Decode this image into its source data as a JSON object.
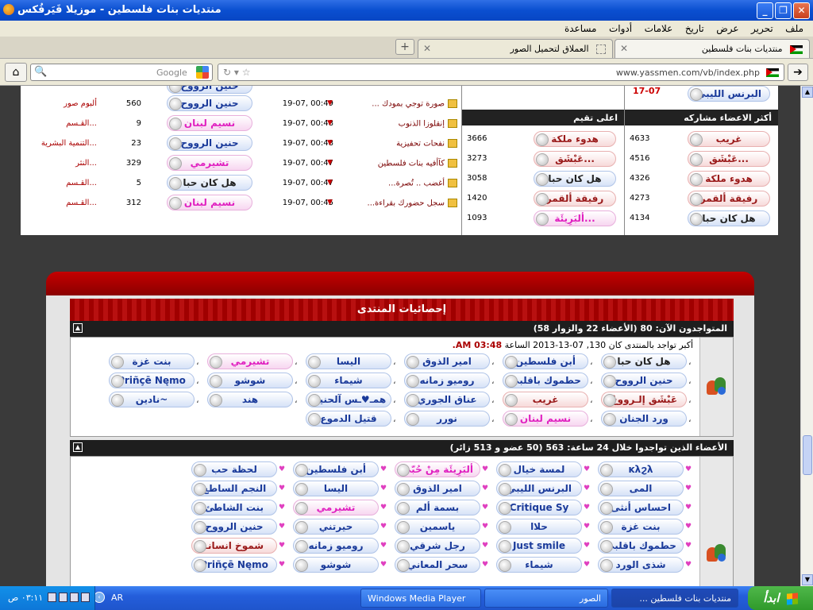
{
  "window": {
    "title": "منتديات بنات فلسطين - موزيلا فَيَرفُكس",
    "buttons": [
      "_",
      "❐",
      "✕"
    ]
  },
  "menu": [
    "ملف",
    "تحرير",
    "عرض",
    "تاريخ",
    "علامات",
    "أدوات",
    "مساعدة"
  ],
  "tabs": [
    {
      "label": "منتديات بنات فلسطين",
      "active": true
    },
    {
      "label": "العملاق لتحميل الصور",
      "active": false
    }
  ],
  "new_tab": "+",
  "nav": {
    "url": "www.yassmen.com/vb/index.php",
    "search_placeholder": "Google"
  },
  "latest": [
    {
      "topic": "صورة توجي بمودك ...",
      "time": "19-07, 00:49",
      "poster": "حنين الرووح",
      "poster_style": "blue",
      "replies": "560",
      "forum": "ألبوم صور"
    },
    {
      "topic": "إنقلوزا الذنوب",
      "time": "19-07, 00:48",
      "poster": "نسيم لبنان",
      "poster_style": "pink",
      "replies": "9",
      "forum": "القـسم..."
    },
    {
      "topic": "نفحات تحفيزية",
      "time": "19-07, 00:48",
      "poster": "حنين الرووح",
      "poster_style": "blue",
      "replies": "23",
      "forum": "التنمية البشرية..."
    },
    {
      "topic": "كآأفيه بنات فلسطين",
      "time": "19-07, 00:47",
      "poster": "تشيرمي",
      "poster_style": "pink",
      "replies": "329",
      "forum": "النثر..."
    },
    {
      "topic": "أغضب .. تُصرة...",
      "time": "19-07, 00:47",
      "poster": "هل كان حبا",
      "poster_style": "dark",
      "replies": "5",
      "forum": "القـسم..."
    },
    {
      "topic": "سجل حضورك بقراءة...",
      "time": "19-07, 00:45",
      "poster": "نسيم لبنان",
      "poster_style": "pink",
      "replies": "312",
      "forum": "القـسم..."
    }
  ],
  "partial_top_poster": "حنين الرووح",
  "top_rated": {
    "title": "اعلى تقيم",
    "rows": [
      {
        "name": "هدوء ملكة",
        "value": "3666",
        "style": "red"
      },
      {
        "name": "عَبْشَق...",
        "value": "3273",
        "style": "red"
      },
      {
        "name": "هل كان حبا",
        "value": "3058",
        "style": "dark"
      },
      {
        "name": "رفيقة ألقمر",
        "value": "1420",
        "style": "red"
      },
      {
        "name": "ألبَرِيئَة...",
        "value": "1093",
        "style": "pink"
      }
    ]
  },
  "top_posters": {
    "title": "أكثر الاعضاء مشاركه",
    "top_name": "البرنس الليبي",
    "top_date": "17-07",
    "rows": [
      {
        "name": "غريب",
        "value": "4633",
        "style": "red"
      },
      {
        "name": "عَبْشَق...",
        "value": "4516",
        "style": "red"
      },
      {
        "name": "هدوء ملكة",
        "value": "4326",
        "style": "red"
      },
      {
        "name": "رفيقة ألقمر",
        "value": "4273",
        "style": "red"
      },
      {
        "name": "هل كان حبا",
        "value": "4134",
        "style": "dark"
      }
    ]
  },
  "stats": {
    "title": "إحصائيات المنتدى",
    "online_header": "المتواجدون الآن: 80 (الأعضاء 22 والزوار 58)",
    "record_text": "أكبر تواجد بالمنتدى كان 130, 07-13-2013 الساعة",
    "record_time": "03:48 AM.",
    "online_users": [
      {
        "name": "هل كان حبا",
        "style": "dark"
      },
      {
        "name": "أبن فلسطين",
        "style": "blue"
      },
      {
        "name": "امير الذوق",
        "style": "blue"
      },
      {
        "name": "اليسا",
        "style": "blue"
      },
      {
        "name": "تشيرمي",
        "style": "pink"
      },
      {
        "name": "بنت غزة",
        "style": "blue"
      },
      {
        "name": "حنين الرووح",
        "style": "blue"
      },
      {
        "name": "حطموك باقلبي",
        "style": "blue"
      },
      {
        "name": "روميو زمانه",
        "style": "blue"
      },
      {
        "name": "شيماء",
        "style": "blue"
      },
      {
        "name": "شوشو",
        "style": "blue"
      },
      {
        "name": "Priñçē Nęmo",
        "style": "blue"
      },
      {
        "name": "عَبْشَق إلـرووحْ",
        "style": "red"
      },
      {
        "name": "غريب",
        "style": "red"
      },
      {
        "name": "عناق الجوري",
        "style": "blue"
      },
      {
        "name": "همـ♥ـس آلحنين",
        "style": "blue"
      },
      {
        "name": "هند",
        "style": "blue"
      },
      {
        "name": "نادين~",
        "style": "blue"
      },
      {
        "name": "ورد الجنان",
        "style": "blue"
      },
      {
        "name": "نسيم لبنان",
        "style": "pink"
      },
      {
        "name": "نورر",
        "style": "blue"
      },
      {
        "name": "قتيل الدموع",
        "style": "blue"
      }
    ],
    "day_header": "الأعضاء الذين تواجدوا خلال 24 ساعة: 563 (50 عضو و 513 زائر)",
    "day_users": [
      {
        "name": "ĸλϩλ",
        "style": "blue"
      },
      {
        "name": "لمسة خيال",
        "style": "blue"
      },
      {
        "name": "ألبَرِيئَة مِنْ حُبّي",
        "style": "pink"
      },
      {
        "name": "أبن فلسطين",
        "style": "blue"
      },
      {
        "name": "لحظة حب",
        "style": "blue"
      },
      {
        "name": "المى",
        "style": "blue"
      },
      {
        "name": "البرنس الليبي",
        "style": "blue"
      },
      {
        "name": "امير الذوق",
        "style": "blue"
      },
      {
        "name": "اليسا",
        "style": "blue"
      },
      {
        "name": "النجم الساطع",
        "style": "blue"
      },
      {
        "name": "احساس أنثى",
        "style": "blue"
      },
      {
        "name": "Critique Sy",
        "style": "blue"
      },
      {
        "name": "بسمة ألم",
        "style": "blue"
      },
      {
        "name": "تشيرمي",
        "style": "pink"
      },
      {
        "name": "بنت الشاطئ",
        "style": "blue"
      },
      {
        "name": "بنت غزة",
        "style": "blue"
      },
      {
        "name": "حلاا",
        "style": "blue"
      },
      {
        "name": "ياسمين",
        "style": "blue"
      },
      {
        "name": "حيرتني",
        "style": "blue"
      },
      {
        "name": "حنين الرووح",
        "style": "blue"
      },
      {
        "name": "حطموك باقلبي",
        "style": "blue"
      },
      {
        "name": "Just smile",
        "style": "blue"
      },
      {
        "name": "رجل شرقي",
        "style": "blue"
      },
      {
        "name": "روميو زمانه",
        "style": "blue"
      },
      {
        "name": "شموخ انسانـ",
        "style": "red"
      },
      {
        "name": "شذى الورد",
        "style": "blue"
      },
      {
        "name": "شيماء",
        "style": "blue"
      },
      {
        "name": "سحر المعاني",
        "style": "blue"
      },
      {
        "name": "شوشو",
        "style": "blue"
      },
      {
        "name": "Priñçē Nęmo",
        "style": "blue"
      }
    ]
  },
  "taskbar": {
    "start": "ابدأ",
    "tasks": [
      {
        "label": "منتديات بنات فلسطين ...",
        "active": true
      },
      {
        "label": "الصور",
        "active": false
      },
      {
        "label": "Windows Media Player",
        "active": false
      }
    ],
    "lang": "AR",
    "clock": "٠٣:١١ ص"
  }
}
